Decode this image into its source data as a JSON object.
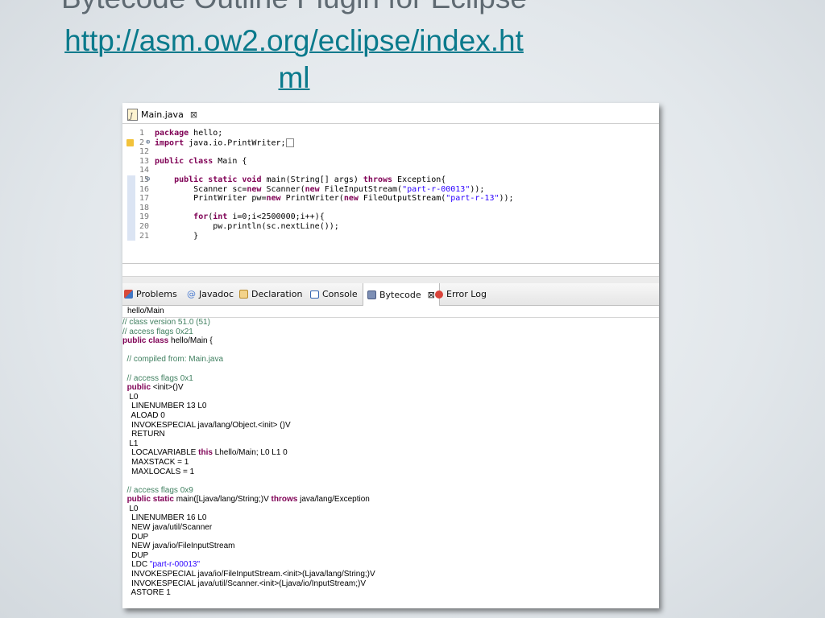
{
  "slide": {
    "title": "Bytecode Outline Plugin for Eclipse",
    "link_line1": "http://asm.ow2.org/eclipse/index.ht",
    "link_line2": "ml"
  },
  "editor": {
    "tab_label": "Main.java",
    "tab_close": "⊠",
    "lines": [
      {
        "num": "1",
        "marker": "",
        "warn": false,
        "hl": false,
        "parts": [
          {
            "t": "kw",
            "v": "package"
          },
          {
            "t": "",
            "v": " hello;"
          }
        ]
      },
      {
        "num": "2",
        "marker": "⊕",
        "warn": true,
        "hl": false,
        "parts": [
          {
            "t": "kw",
            "v": "import"
          },
          {
            "t": "",
            "v": " java.io.PrintWriter;"
          },
          {
            "t": "fold",
            "v": ""
          }
        ]
      },
      {
        "num": "12",
        "marker": "",
        "warn": false,
        "hl": false,
        "parts": []
      },
      {
        "num": "13",
        "marker": "",
        "warn": false,
        "hl": false,
        "parts": [
          {
            "t": "kw",
            "v": "public class"
          },
          {
            "t": "",
            "v": " Main {"
          }
        ]
      },
      {
        "num": "14",
        "marker": "",
        "warn": false,
        "hl": false,
        "parts": []
      },
      {
        "num": "15",
        "marker": "⊖",
        "warn": false,
        "hl": true,
        "parts": [
          {
            "t": "",
            "v": "    "
          },
          {
            "t": "kw",
            "v": "public static void"
          },
          {
            "t": "",
            "v": " main(String[] args) "
          },
          {
            "t": "kw",
            "v": "throws"
          },
          {
            "t": "",
            "v": " Exception{"
          }
        ]
      },
      {
        "num": "16",
        "marker": "",
        "warn": false,
        "hl": true,
        "parts": [
          {
            "t": "",
            "v": "        Scanner sc="
          },
          {
            "t": "kw",
            "v": "new"
          },
          {
            "t": "",
            "v": " Scanner("
          },
          {
            "t": "kw",
            "v": "new"
          },
          {
            "t": "",
            "v": " FileInputStream("
          },
          {
            "t": "str",
            "v": "\"part-r-00013\""
          },
          {
            "t": "",
            "v": "));"
          }
        ]
      },
      {
        "num": "17",
        "marker": "",
        "warn": false,
        "hl": true,
        "parts": [
          {
            "t": "",
            "v": "        PrintWriter pw="
          },
          {
            "t": "kw",
            "v": "new"
          },
          {
            "t": "",
            "v": " PrintWriter("
          },
          {
            "t": "kw",
            "v": "new"
          },
          {
            "t": "",
            "v": " FileOutputStream("
          },
          {
            "t": "str",
            "v": "\"part-r-13\""
          },
          {
            "t": "",
            "v": "));"
          }
        ]
      },
      {
        "num": "18",
        "marker": "",
        "warn": false,
        "hl": true,
        "parts": []
      },
      {
        "num": "19",
        "marker": "",
        "warn": false,
        "hl": true,
        "parts": [
          {
            "t": "",
            "v": "        "
          },
          {
            "t": "kw",
            "v": "for"
          },
          {
            "t": "",
            "v": "("
          },
          {
            "t": "kw",
            "v": "int"
          },
          {
            "t": "",
            "v": " i=0;i<2500000;i++){"
          }
        ]
      },
      {
        "num": "20",
        "marker": "",
        "warn": false,
        "hl": true,
        "parts": [
          {
            "t": "",
            "v": "            pw.println(sc.nextLine());"
          }
        ]
      },
      {
        "num": "21",
        "marker": "",
        "warn": false,
        "hl": true,
        "parts": [
          {
            "t": "",
            "v": "        }"
          }
        ]
      }
    ]
  },
  "views": {
    "tabs": [
      {
        "id": "problems",
        "label": "Problems",
        "icon": "problems-icon"
      },
      {
        "id": "javadoc",
        "label": "Javadoc",
        "icon": "at-icon"
      },
      {
        "id": "declaration",
        "label": "Declaration",
        "icon": "declaration-icon"
      },
      {
        "id": "console",
        "label": "Console",
        "icon": "console-icon"
      },
      {
        "id": "bytecode",
        "label": "Bytecode",
        "icon": "bytecode-icon",
        "active": true
      },
      {
        "id": "errorlog",
        "label": "Error Log",
        "icon": "error-log-icon"
      }
    ],
    "active_close": "⊠",
    "path": "hello/Main",
    "bytecode": [
      [
        {
          "t": "cm",
          "v": "// class version 51.0 (51)"
        }
      ],
      [
        {
          "t": "cm",
          "v": "// access flags 0x21"
        }
      ],
      [
        {
          "t": "bk",
          "v": "public class"
        },
        {
          "t": "",
          "v": " hello/Main {"
        }
      ],
      [],
      [
        {
          "t": "cm",
          "v": "  // compiled from: Main.java"
        }
      ],
      [],
      [
        {
          "t": "cm",
          "v": "  // access flags 0x1"
        }
      ],
      [
        {
          "t": "",
          "v": "  "
        },
        {
          "t": "bk",
          "v": "public"
        },
        {
          "t": "",
          "v": " <init>()V"
        }
      ],
      [
        {
          "t": "",
          "v": "   L0"
        }
      ],
      [
        {
          "t": "",
          "v": "    LINENUMBER 13 L0"
        }
      ],
      [
        {
          "t": "",
          "v": "    ALOAD 0"
        }
      ],
      [
        {
          "t": "",
          "v": "    INVOKESPECIAL java/lang/Object.<init> ()V"
        }
      ],
      [
        {
          "t": "",
          "v": "    RETURN"
        }
      ],
      [
        {
          "t": "",
          "v": "   L1"
        }
      ],
      [
        {
          "t": "",
          "v": "    LOCALVARIABLE "
        },
        {
          "t": "bk",
          "v": "this"
        },
        {
          "t": "",
          "v": " Lhello/Main; L0 L1 0"
        }
      ],
      [
        {
          "t": "",
          "v": "    MAXSTACK = 1"
        }
      ],
      [
        {
          "t": "",
          "v": "    MAXLOCALS = 1"
        }
      ],
      [],
      [
        {
          "t": "cm",
          "v": "  // access flags 0x9"
        }
      ],
      [
        {
          "t": "",
          "v": "  "
        },
        {
          "t": "bk",
          "v": "public static"
        },
        {
          "t": "",
          "v": " main([Ljava/lang/String;)V "
        },
        {
          "t": "bk",
          "v": "throws"
        },
        {
          "t": "",
          "v": " java/lang/Exception"
        }
      ],
      [
        {
          "t": "",
          "v": "   L0"
        }
      ],
      [
        {
          "t": "",
          "v": "    LINENUMBER 16 L0"
        }
      ],
      [
        {
          "t": "",
          "v": "    NEW java/util/Scanner"
        }
      ],
      [
        {
          "t": "",
          "v": "    DUP"
        }
      ],
      [
        {
          "t": "",
          "v": "    NEW java/io/FileInputStream"
        }
      ],
      [
        {
          "t": "",
          "v": "    DUP"
        }
      ],
      [
        {
          "t": "",
          "v": "    LDC "
        },
        {
          "t": "bs",
          "v": "\"part-r-00013\""
        }
      ],
      [
        {
          "t": "",
          "v": "    INVOKESPECIAL java/io/FileInputStream.<init>(Ljava/lang/String;)V"
        }
      ],
      [
        {
          "t": "",
          "v": "    INVOKESPECIAL java/util/Scanner.<init>(Ljava/io/InputStream;)V"
        }
      ],
      [
        {
          "t": "",
          "v": "    ASTORE 1"
        }
      ]
    ]
  }
}
